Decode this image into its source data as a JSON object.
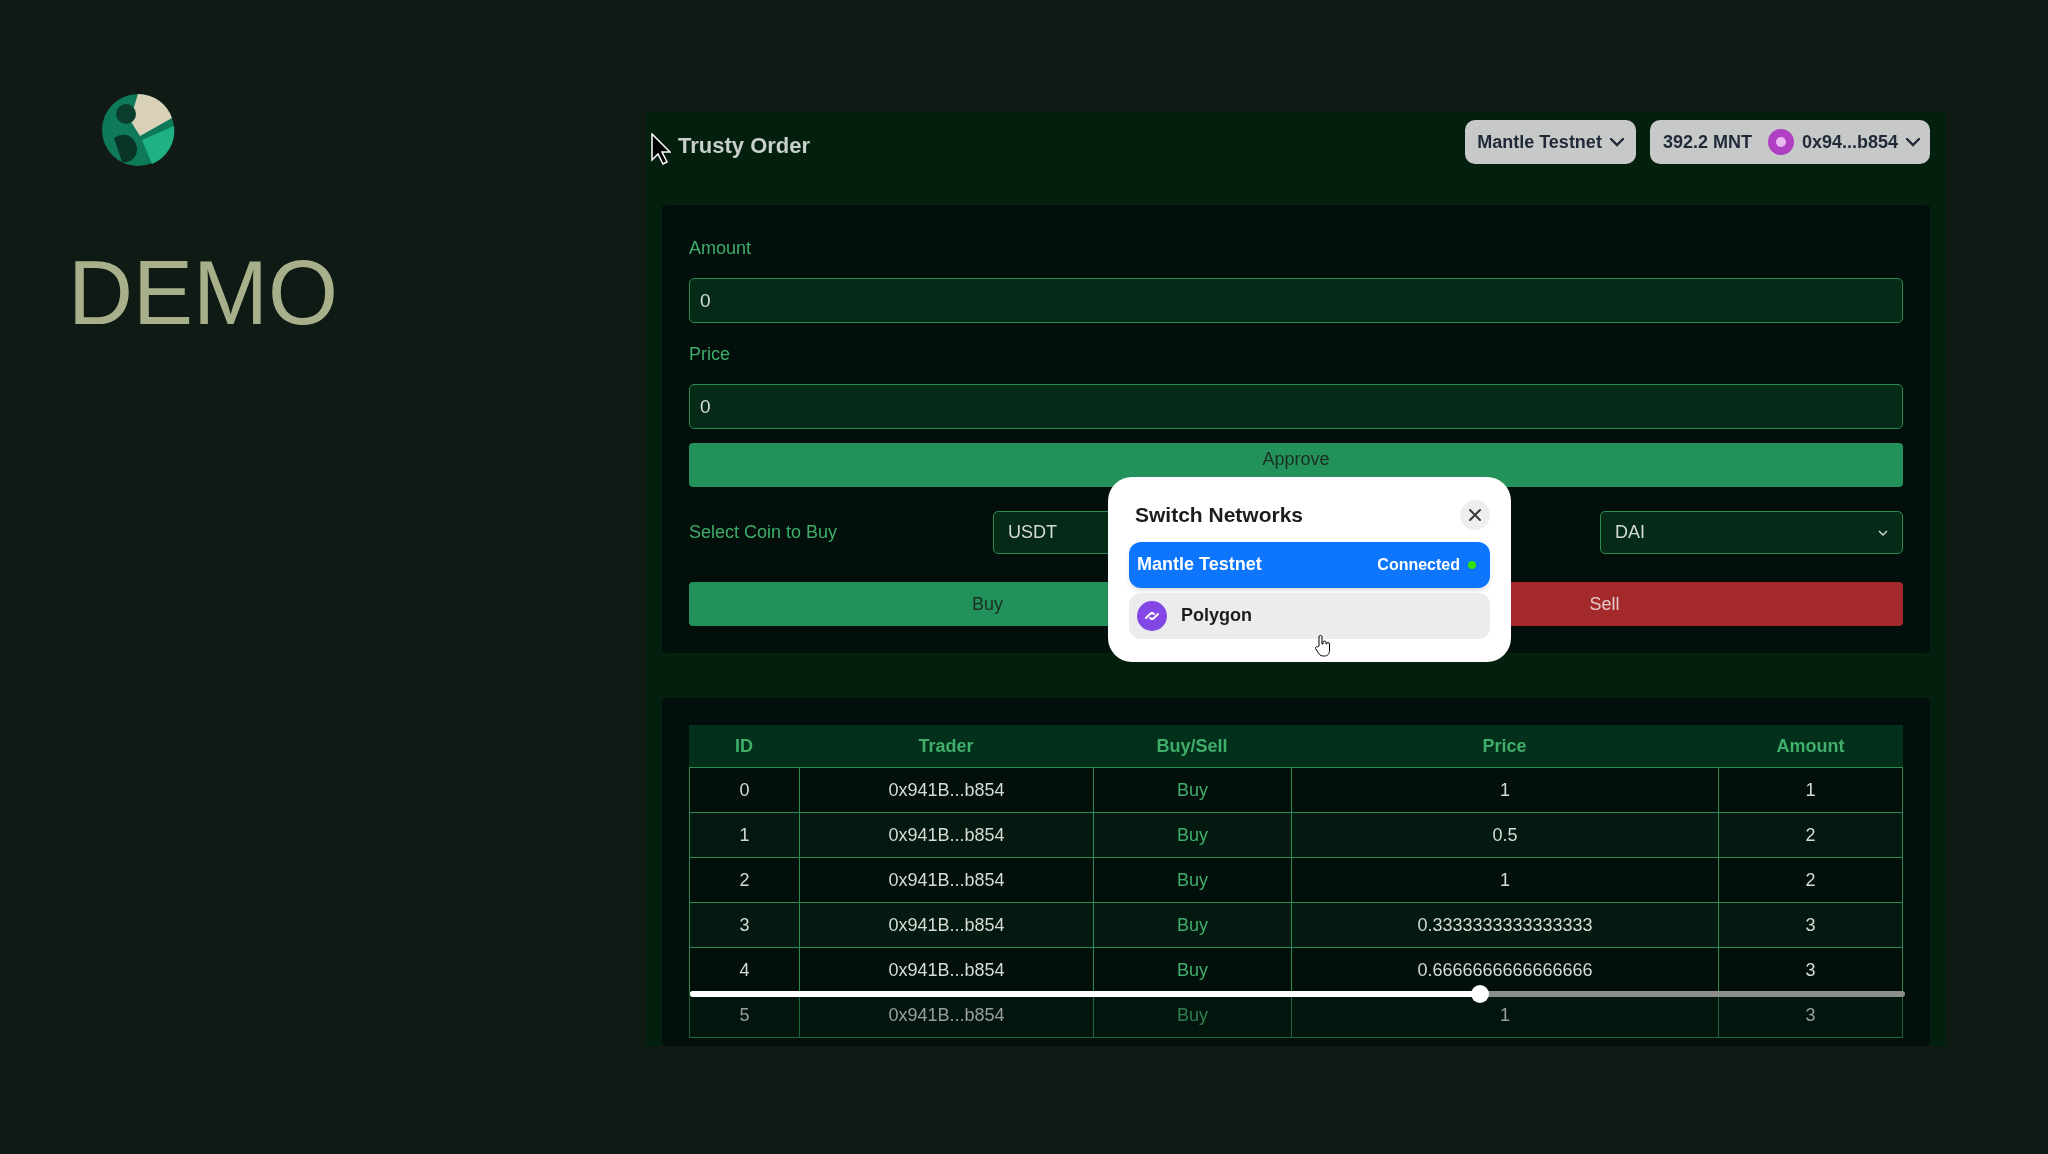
{
  "sidebar": {
    "title": "DEMO"
  },
  "app": {
    "title": "Trusty Order",
    "network_button": "Mantle Testnet",
    "balance": "392.2 MNT",
    "account": "0x94...b854"
  },
  "form": {
    "amount": {
      "label": "Amount",
      "value": "0"
    },
    "price": {
      "label": "Price",
      "value": "0"
    },
    "approve_button": "Approve",
    "buy_select": {
      "label": "Select Coin to Buy",
      "value": "USDT"
    },
    "sell_select": {
      "value": "DAI"
    },
    "buy_button": "Buy",
    "sell_button": "Sell"
  },
  "table": {
    "columns": [
      "ID",
      "Trader",
      "Buy/Sell",
      "Price",
      "Amount"
    ],
    "rows": [
      {
        "cells": [
          "0",
          "0x941B...b854",
          "Buy",
          "1",
          "1"
        ]
      },
      {
        "cells": [
          "1",
          "0x941B...b854",
          "Buy",
          "0.5",
          "2"
        ]
      },
      {
        "cells": [
          "2",
          "0x941B...b854",
          "Buy",
          "1",
          "2"
        ]
      },
      {
        "cells": [
          "3",
          "0x941B...b854",
          "Buy",
          "0.3333333333333333",
          "3"
        ]
      },
      {
        "cells": [
          "4",
          "0x941B...b854",
          "Buy",
          "0.6666666666666666",
          "3"
        ]
      },
      {
        "cells": [
          "5",
          "0x941B...b854",
          "Buy",
          "1",
          "3"
        ]
      }
    ]
  },
  "modal": {
    "title": "Switch Networks",
    "networks": [
      {
        "name": "Mantle Testnet",
        "selected": true,
        "status": "Connected"
      },
      {
        "name": "Polygon",
        "selected": false
      }
    ]
  },
  "video_scrubber": {
    "level": 0.65
  }
}
